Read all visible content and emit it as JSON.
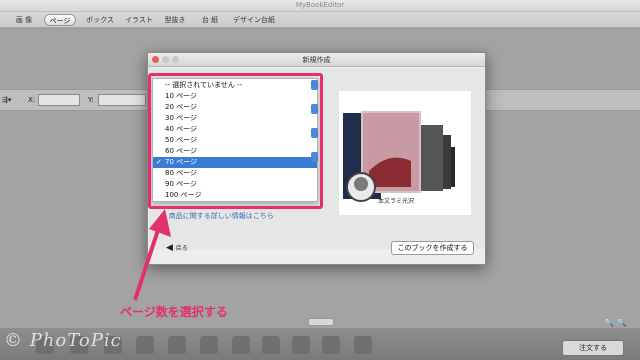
{
  "app": {
    "title": "MyBookEditor"
  },
  "toolbar": {
    "tabs": [
      {
        "label": "画 像"
      },
      {
        "label": "ページ"
      },
      {
        "label": "ボックス"
      },
      {
        "label": "イラスト"
      },
      {
        "label": "型抜き"
      },
      {
        "label": "台 紙"
      },
      {
        "label": "デザイン台紙"
      }
    ]
  },
  "coords": {
    "x_label": "X:",
    "y_label": "Y:"
  },
  "dialog": {
    "title": "新規作成",
    "dropdown": {
      "options": [
        "-- 選択されていません --",
        "10 ページ",
        "20 ページ",
        "30 ページ",
        "40 ページ",
        "50 ページ",
        "60 ページ",
        "70 ページ",
        "80 ページ",
        "90 ページ",
        "100 ページ"
      ],
      "selected": "70 ページ",
      "check": "✓"
    },
    "preview_caption": "本文ラミ光沢",
    "footer_link": "商品に関する詳しい情報はこちら",
    "back_label": "戻る",
    "create_label": "このブックを作成する"
  },
  "annotation": {
    "callout": "ページ数を選択する",
    "color": "#e0316e"
  },
  "bottom": {
    "order_label": "注文する",
    "watermark": "© PhoToPic"
  }
}
